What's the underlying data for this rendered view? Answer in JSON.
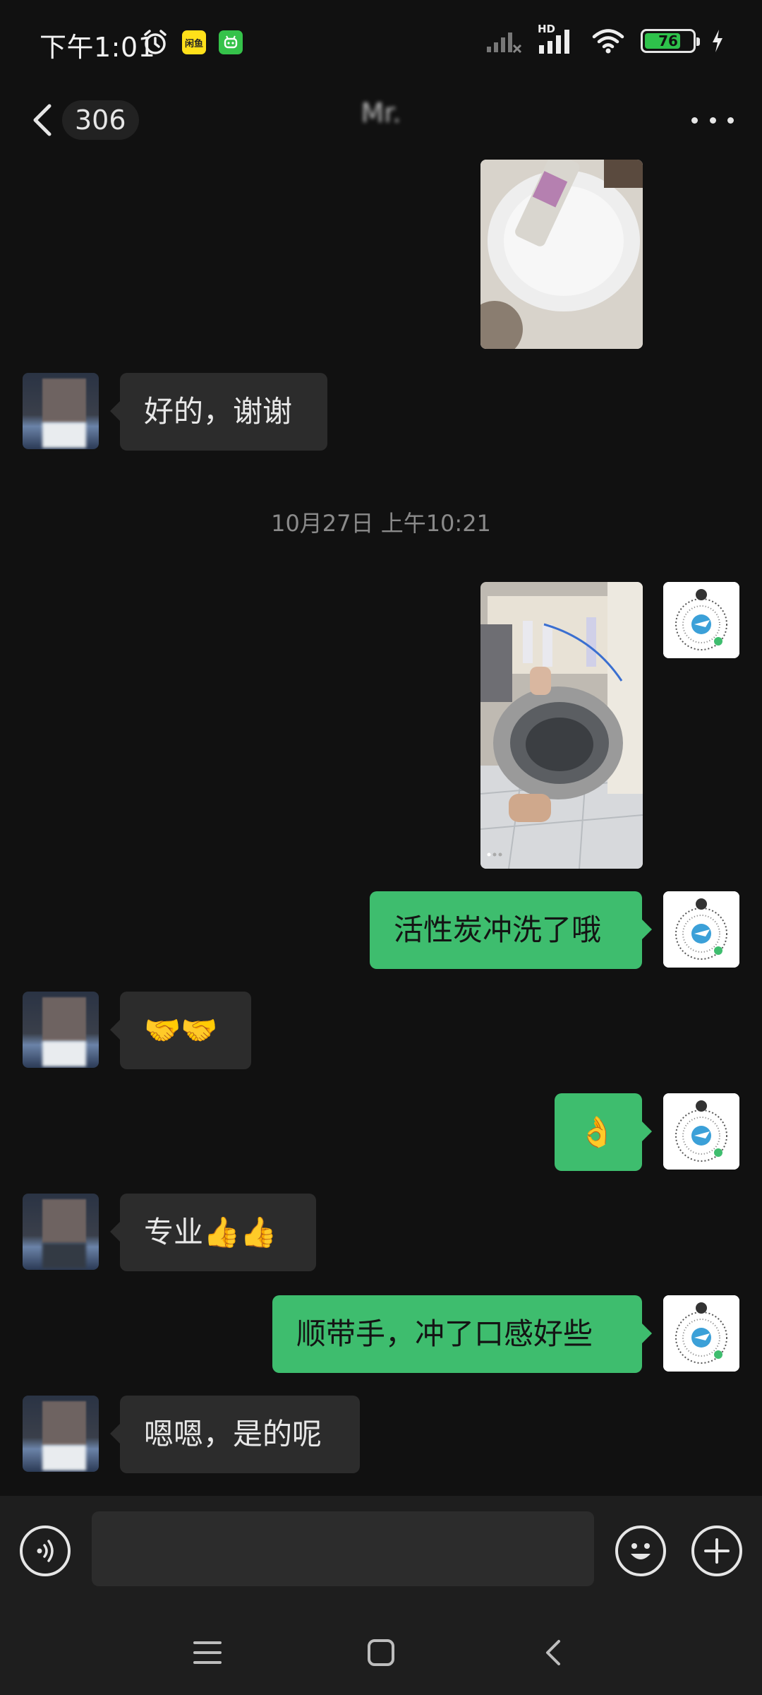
{
  "status_bar": {
    "time": "下午1:01",
    "app_icon_1": "闲鱼",
    "network_label": "HD",
    "battery_level": "76",
    "battery_fraction": 0.76,
    "icons": [
      "alarm-icon",
      "xianyu-app-icon",
      "robot-app-icon",
      "signal-icon",
      "wifi-icon",
      "battery-icon",
      "charging-icon"
    ]
  },
  "header": {
    "unread_count": "306",
    "title": "Mr.",
    "back_icon": "chevron-left-icon",
    "more_icon": "more-dots-icon"
  },
  "chat": {
    "timestamp": "10月27日 上午10:21",
    "messages": [
      {
        "from": "me",
        "type": "image",
        "desc": "tds-tester-photo"
      },
      {
        "from": "other",
        "type": "text",
        "text": "好的，谢谢"
      },
      {
        "from": "me",
        "type": "image",
        "desc": "water-filter-photo"
      },
      {
        "from": "me",
        "type": "text",
        "text": "活性炭冲洗了哦"
      },
      {
        "from": "other",
        "type": "text",
        "text": "🤝🤝"
      },
      {
        "from": "me",
        "type": "text",
        "text": "👌"
      },
      {
        "from": "other",
        "type": "text",
        "text": "专业👍👍"
      },
      {
        "from": "me",
        "type": "text",
        "text": "顺带手，冲了口感好些"
      },
      {
        "from": "other",
        "type": "text",
        "text": "嗯嗯，是的呢"
      }
    ]
  },
  "input_bar": {
    "voice_icon": "voice-icon",
    "emoji_icon": "emoji-icon",
    "plus_icon": "plus-icon",
    "placeholder": ""
  },
  "nav_bar": {
    "icons": [
      "menu-icon",
      "home-icon",
      "back-icon"
    ]
  },
  "colors": {
    "background": "#111111",
    "bubble_in": "#2c2c2c",
    "bubble_out": "#3ebd6e",
    "accent_green": "#2ec24b"
  }
}
